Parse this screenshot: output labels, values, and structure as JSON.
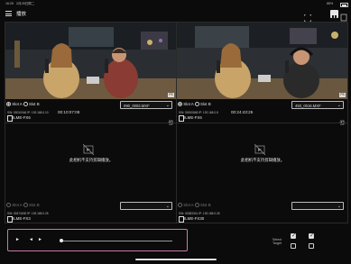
{
  "status_bar": {
    "time": "16:25",
    "date": "2月28日周二",
    "battery": "88%"
  },
  "header": {
    "title": "播放",
    "menu_icon": "hamburger-icon",
    "fullscreen_icon": "fullscreen-icon",
    "layout_icon": "grid-layout-icon"
  },
  "cameras": [
    {
      "slot_a": "Slot A",
      "slot_b": "Slot B",
      "selected_slot": "Slot A",
      "clip": "090_0003.MXF",
      "timecode": "00:10:07:08",
      "info": "S/N: 50010046   IP: 192.168.0.10",
      "model": "ILME-FX6",
      "badge": "PS"
    },
    {
      "slot_a": "Slot A",
      "slot_b": "Slot B",
      "selected_slot": "Slot A",
      "clip": "493_0016.MXF",
      "timecode": "00:24:43:25",
      "info": "S/N: 50000848   IP: 192.168.0.8",
      "model": "ILME-FX6",
      "badge": "PS"
    },
    {
      "message": "此相机不支持剪辑播放。",
      "slot_a": "Slot A",
      "slot_b": "Slot B",
      "info": "S/N: 50474630   IP: 192.168.0.25",
      "model": "ILME-FX3"
    },
    {
      "message": "此相机不支持剪辑播放。",
      "slot_a": "Slot A",
      "slot_b": "Slot B",
      "info": "S/N: 50383341   IP: 192.168.0.26",
      "model": "ILME-FX30"
    }
  ],
  "transport": {
    "play": "►",
    "prev": "◄",
    "next": "►"
  },
  "select_target": {
    "label_line1": "Select",
    "label_line2": "Target",
    "checks": [
      true,
      true,
      false,
      false
    ]
  },
  "colors": {
    "accent_border": "#c77aa8",
    "background": "#0b0b0b"
  }
}
